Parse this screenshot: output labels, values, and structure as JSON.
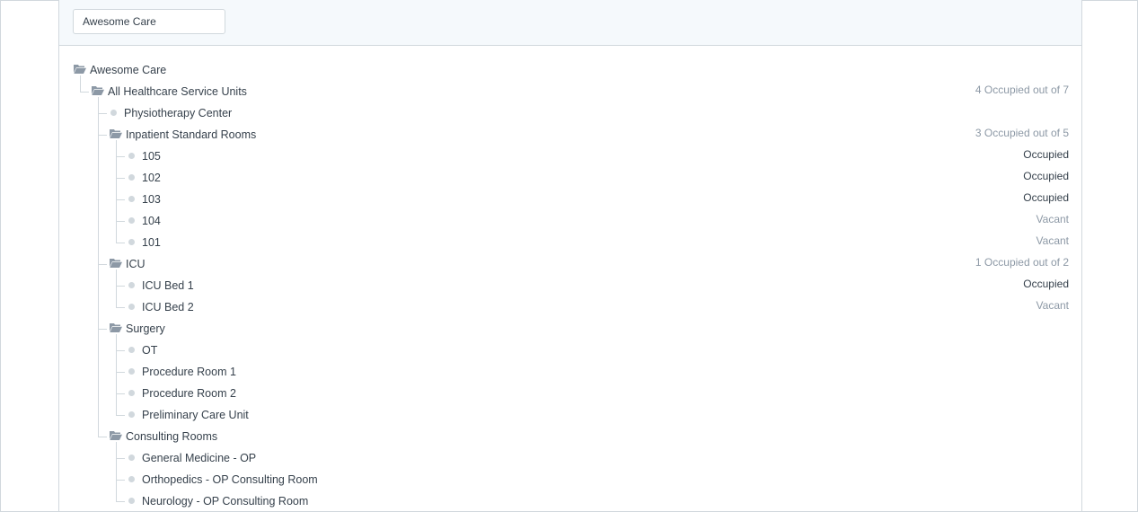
{
  "toolbar": {
    "company_value": "Awesome Care"
  },
  "tree": {
    "root": {
      "label": "Awesome Care",
      "icon": "folder-open-icon"
    },
    "all_units": {
      "label": "All Healthcare Service Units",
      "stat": "4 Occupied out of 7"
    },
    "physiotherapy": {
      "label": "Physiotherapy Center"
    },
    "inpatient": {
      "label": "Inpatient Standard Rooms",
      "stat": "3 Occupied out of 5",
      "children": [
        {
          "label": "105",
          "stat": "Occupied"
        },
        {
          "label": "102",
          "stat": "Occupied"
        },
        {
          "label": "103",
          "stat": "Occupied"
        },
        {
          "label": "104",
          "stat": "Vacant"
        },
        {
          "label": "101",
          "stat": "Vacant"
        }
      ]
    },
    "icu": {
      "label": "ICU",
      "stat": "1 Occupied out of 2",
      "children": [
        {
          "label": "ICU Bed 1",
          "stat": "Occupied"
        },
        {
          "label": "ICU Bed 2",
          "stat": "Vacant"
        }
      ]
    },
    "surgery": {
      "label": "Surgery",
      "children": [
        {
          "label": "OT"
        },
        {
          "label": "Procedure Room 1"
        },
        {
          "label": "Procedure Room 2"
        },
        {
          "label": "Preliminary Care Unit"
        }
      ]
    },
    "consulting": {
      "label": "Consulting Rooms",
      "children": [
        {
          "label": "General Medicine - OP"
        },
        {
          "label": "Orthopedics - OP Consulting Room"
        },
        {
          "label": "Neurology - OP Consulting Room"
        }
      ]
    }
  },
  "colors": {
    "text": "#36414c",
    "muted": "#8d99a6",
    "border": "#d1d8dd",
    "toolbar_bg": "#f5f9fc",
    "folder": "#8d99a6"
  }
}
